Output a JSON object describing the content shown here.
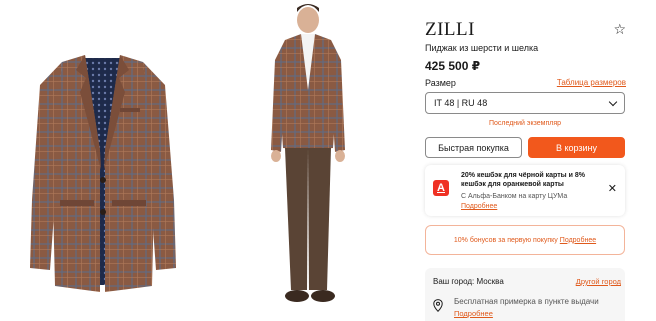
{
  "product": {
    "brand": "ZILLI",
    "title": "Пиджак из шерсти и шелка",
    "price": "425 500 ₽",
    "favorite_icon": "☆"
  },
  "size": {
    "label": "Размер",
    "table_link": "Таблица размеров",
    "selected": "IT 48 | RU 48",
    "stock_note": "Последний экземпляр"
  },
  "actions": {
    "quick_buy": "Быстрая покупка",
    "add_to_cart": "В корзину"
  },
  "promo": {
    "logo_letter": "А",
    "line1": "20% кешбэк для чёрной карты и 8%",
    "line2": "кешбэк для оранжевой карты",
    "line3": "С Альфа-Банком на карту ЦУМа",
    "link": "Подробнее",
    "close": "✕"
  },
  "bonus": {
    "text": "10% бонусов за первую покупку",
    "link": "Подробнее"
  },
  "delivery": {
    "city_label": "Ваш город: Москва",
    "other_city": "Другой город",
    "fitting_text": "Бесплатная примерка в пункте выдачи",
    "fitting_link": "Подробнее"
  },
  "colors": {
    "accent": "#f2581c",
    "link": "#e05a1c",
    "jacket": "#8a5a43",
    "trousers": "#5a4435"
  }
}
